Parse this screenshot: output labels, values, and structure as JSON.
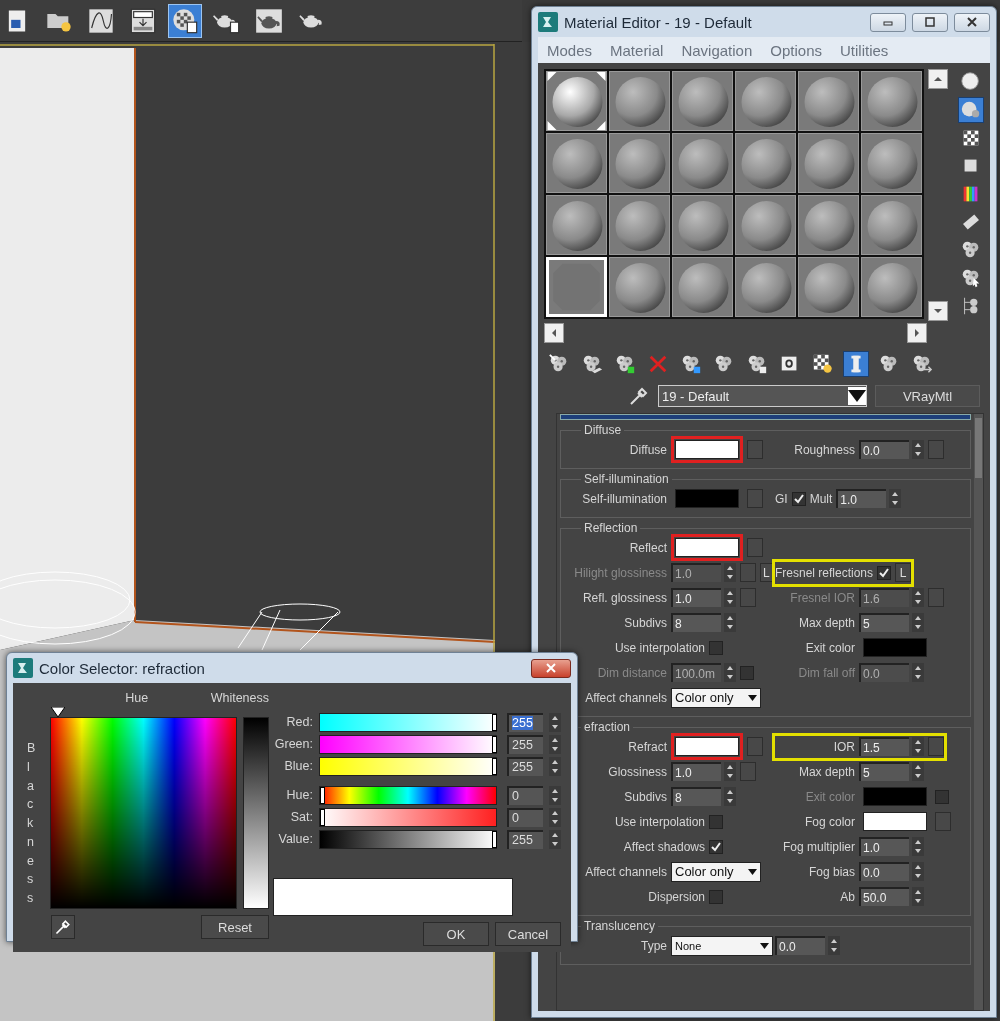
{
  "toolbar": {
    "tools": [
      {
        "kind": "doc",
        "selected": false
      },
      {
        "kind": "folder-bulb",
        "selected": false
      },
      {
        "kind": "curve",
        "selected": false
      },
      {
        "kind": "down-box",
        "selected": false
      },
      {
        "kind": "checker-sphere",
        "selected": true
      },
      {
        "kind": "teapot-doc",
        "selected": false
      },
      {
        "kind": "teapot-frame",
        "selected": false
      },
      {
        "kind": "teapot",
        "selected": false
      }
    ]
  },
  "material_editor": {
    "title": "Material Editor - 19 - Default",
    "menu": [
      "Modes",
      "Material",
      "Navigation",
      "Options",
      "Utilities"
    ],
    "slots": [
      {
        "kind": "sphere",
        "hot": true,
        "selected": false
      },
      {
        "kind": "sphere",
        "hot": false,
        "selected": false
      },
      {
        "kind": "sphere",
        "hot": false,
        "selected": false
      },
      {
        "kind": "sphere",
        "hot": false,
        "selected": false
      },
      {
        "kind": "sphere",
        "hot": false,
        "selected": false
      },
      {
        "kind": "sphere",
        "hot": false,
        "selected": false
      },
      {
        "kind": "sphere",
        "hot": false,
        "selected": false
      },
      {
        "kind": "sphere",
        "hot": false,
        "selected": false
      },
      {
        "kind": "sphere",
        "hot": false,
        "selected": false
      },
      {
        "kind": "sphere",
        "hot": false,
        "selected": false
      },
      {
        "kind": "sphere",
        "hot": false,
        "selected": false
      },
      {
        "kind": "sphere",
        "hot": false,
        "selected": false
      },
      {
        "kind": "sphere",
        "hot": false,
        "selected": false
      },
      {
        "kind": "sphere",
        "hot": false,
        "selected": false
      },
      {
        "kind": "sphere",
        "hot": false,
        "selected": false
      },
      {
        "kind": "sphere",
        "hot": false,
        "selected": false
      },
      {
        "kind": "sphere",
        "hot": false,
        "selected": false
      },
      {
        "kind": "sphere",
        "hot": false,
        "selected": false
      },
      {
        "kind": "flat",
        "hot": false,
        "selected": true
      },
      {
        "kind": "sphere",
        "hot": false,
        "selected": false
      },
      {
        "kind": "sphere",
        "hot": false,
        "selected": false
      },
      {
        "kind": "sphere",
        "hot": false,
        "selected": false
      },
      {
        "kind": "sphere",
        "hot": false,
        "selected": false
      },
      {
        "kind": "sphere",
        "hot": false,
        "selected": false
      }
    ],
    "side_tools": [
      {
        "kind": "sphere",
        "selected": false
      },
      {
        "kind": "sphere-backlight",
        "selected": true
      },
      {
        "kind": "checker",
        "selected": false
      },
      {
        "kind": "square",
        "selected": false
      },
      {
        "kind": "color-bars",
        "selected": false
      },
      {
        "kind": "film",
        "selected": false
      },
      {
        "kind": "cluster",
        "selected": false
      },
      {
        "kind": "cluster-cursor",
        "selected": false
      },
      {
        "kind": "cluster-tree",
        "selected": false
      }
    ],
    "bottom_tools": [
      {
        "kind": "cluster-wand",
        "selected": false
      },
      {
        "kind": "cluster-plane",
        "selected": false
      },
      {
        "kind": "cluster-cube",
        "selected": false
      },
      {
        "kind": "delete",
        "selected": false
      },
      {
        "kind": "cluster-arrows",
        "selected": false
      },
      {
        "kind": "cluster-pyramid",
        "selected": false
      },
      {
        "kind": "cluster-doc",
        "selected": false
      },
      {
        "kind": "square-zero",
        "selected": false
      },
      {
        "kind": "checker-bulb",
        "selected": false
      },
      {
        "kind": "pillar",
        "selected": true
      },
      {
        "kind": "cluster-head",
        "selected": false
      },
      {
        "kind": "cluster-head-arrow",
        "selected": false
      }
    ],
    "material_name": "19 - Default",
    "material_type": "VRayMtl",
    "groups": [
      {
        "title": "Diffuse",
        "rows": [
          {
            "left": {
              "disabled": false,
              "highlighted": false,
              "items": [
                {
                  "kind": "label",
                  "text": "Diffuse"
                },
                {
                  "kind": "swatch",
                  "color": "#ffffff",
                  "highlighted": true
                },
                {
                  "kind": "map"
                }
              ]
            },
            "right": {
              "disabled": false,
              "highlighted": false,
              "items": [
                {
                  "kind": "label",
                  "text": "Roughness"
                },
                {
                  "kind": "spinner",
                  "value": "0.0"
                },
                {
                  "kind": "map"
                }
              ]
            }
          }
        ]
      },
      {
        "title": "Self-illumination",
        "rows": [
          {
            "left": {
              "disabled": false,
              "highlighted": false,
              "items": [
                {
                  "kind": "label",
                  "text": "Self-illumination"
                },
                {
                  "kind": "swatch",
                  "color": "#000000",
                  "highlighted": false
                },
                {
                  "kind": "map"
                }
              ]
            },
            "right": {
              "disabled": false,
              "highlighted": false,
              "items": [
                {
                  "kind": "label",
                  "text": "GI"
                },
                {
                  "kind": "check",
                  "checked": true
                },
                {
                  "kind": "label",
                  "text": "Mult"
                },
                {
                  "kind": "spinner",
                  "value": "1.0"
                }
              ]
            }
          }
        ]
      },
      {
        "title": "Reflection",
        "rows": [
          {
            "left": {
              "disabled": false,
              "highlighted": false,
              "items": [
                {
                  "kind": "label",
                  "text": "Reflect"
                },
                {
                  "kind": "swatch",
                  "color": "#ffffff",
                  "highlighted": true
                },
                {
                  "kind": "map"
                }
              ]
            }
          },
          {
            "left": {
              "disabled": true,
              "highlighted": false,
              "items": [
                {
                  "kind": "label",
                  "text": "Hilight glossiness"
                },
                {
                  "kind": "spinner",
                  "value": "1.0"
                },
                {
                  "kind": "map"
                },
                {
                  "kind": "lock",
                  "text": "L"
                }
              ]
            },
            "right": {
              "disabled": false,
              "highlighted": true,
              "items": [
                {
                  "kind": "label",
                  "text": "Fresnel reflections"
                },
                {
                  "kind": "check",
                  "checked": true
                },
                {
                  "kind": "lock",
                  "text": "L"
                }
              ]
            }
          },
          {
            "left": {
              "disabled": false,
              "highlighted": false,
              "items": [
                {
                  "kind": "label",
                  "text": "Refl. glossiness"
                },
                {
                  "kind": "spinner",
                  "value": "1.0"
                },
                {
                  "kind": "map"
                }
              ]
            },
            "right": {
              "disabled": true,
              "highlighted": false,
              "items": [
                {
                  "kind": "label",
                  "text": "Fresnel IOR"
                },
                {
                  "kind": "spinner",
                  "value": "1.6"
                },
                {
                  "kind": "map"
                }
              ]
            }
          },
          {
            "left": {
              "disabled": false,
              "highlighted": false,
              "items": [
                {
                  "kind": "label",
                  "text": "Subdivs"
                },
                {
                  "kind": "spinner",
                  "value": "8"
                }
              ]
            },
            "right": {
              "disabled": false,
              "highlighted": false,
              "items": [
                {
                  "kind": "label",
                  "text": "Max depth"
                },
                {
                  "kind": "spinner",
                  "value": "5"
                }
              ]
            }
          },
          {
            "left": {
              "disabled": false,
              "highlighted": false,
              "items": [
                {
                  "kind": "label",
                  "text": "Use interpolation"
                },
                {
                  "kind": "check",
                  "checked": false
                }
              ]
            },
            "right": {
              "disabled": false,
              "highlighted": false,
              "items": [
                {
                  "kind": "label",
                  "text": "Exit color"
                },
                {
                  "kind": "swatch",
                  "color": "#000000",
                  "highlighted": false
                }
              ]
            }
          },
          {
            "left": {
              "disabled": true,
              "highlighted": false,
              "items": [
                {
                  "kind": "label",
                  "text": "Dim distance"
                },
                {
                  "kind": "spinner",
                  "value": "100.0m"
                },
                {
                  "kind": "check",
                  "checked": false
                }
              ]
            },
            "right": {
              "disabled": true,
              "highlighted": false,
              "items": [
                {
                  "kind": "label",
                  "text": "Dim fall off"
                },
                {
                  "kind": "spinner",
                  "value": "0.0"
                }
              ]
            }
          },
          {
            "left": {
              "disabled": false,
              "highlighted": false,
              "items": [
                {
                  "kind": "label",
                  "text": "Affect channels"
                },
                {
                  "kind": "dropdown",
                  "value": "Color only"
                }
              ]
            }
          }
        ]
      },
      {
        "title": "efraction",
        "rows": [
          {
            "left": {
              "disabled": false,
              "highlighted": false,
              "items": [
                {
                  "kind": "label",
                  "text": "Refract"
                },
                {
                  "kind": "swatch",
                  "color": "#ffffff",
                  "highlighted": true
                },
                {
                  "kind": "map"
                }
              ]
            },
            "right": {
              "disabled": false,
              "highlighted": true,
              "items": [
                {
                  "kind": "label",
                  "text": "IOR"
                },
                {
                  "kind": "spinner",
                  "value": "1.5"
                },
                {
                  "kind": "map"
                }
              ]
            }
          },
          {
            "left": {
              "disabled": false,
              "highlighted": false,
              "items": [
                {
                  "kind": "label",
                  "text": "Glossiness"
                },
                {
                  "kind": "spinner",
                  "value": "1.0"
                },
                {
                  "kind": "map"
                }
              ]
            },
            "right": {
              "disabled": false,
              "highlighted": false,
              "items": [
                {
                  "kind": "label",
                  "text": "Max depth"
                },
                {
                  "kind": "spinner",
                  "value": "5"
                }
              ]
            }
          },
          {
            "left": {
              "disabled": false,
              "highlighted": false,
              "items": [
                {
                  "kind": "label",
                  "text": "Subdivs"
                },
                {
                  "kind": "spinner",
                  "value": "8"
                }
              ]
            },
            "right": {
              "disabled": true,
              "highlighted": false,
              "items": [
                {
                  "kind": "label",
                  "text": "Exit color"
                },
                {
                  "kind": "swatch",
                  "color": "#000000",
                  "highlighted": false
                },
                {
                  "kind": "check",
                  "checked": false
                }
              ]
            }
          },
          {
            "left": {
              "disabled": false,
              "highlighted": false,
              "items": [
                {
                  "kind": "label",
                  "text": "Use interpolation"
                },
                {
                  "kind": "check",
                  "checked": false
                }
              ]
            },
            "right": {
              "disabled": false,
              "highlighted": false,
              "items": [
                {
                  "kind": "label",
                  "text": "Fog color"
                },
                {
                  "kind": "swatch",
                  "color": "#ffffff",
                  "highlighted": false
                },
                {
                  "kind": "map"
                }
              ]
            }
          },
          {
            "left": {
              "disabled": false,
              "highlighted": false,
              "items": [
                {
                  "kind": "label",
                  "text": "Affect shadows"
                },
                {
                  "kind": "check",
                  "checked": true
                }
              ]
            },
            "right": {
              "disabled": false,
              "highlighted": false,
              "items": [
                {
                  "kind": "label",
                  "text": "Fog multiplier"
                },
                {
                  "kind": "spinner",
                  "value": "1.0"
                }
              ]
            }
          },
          {
            "left": {
              "disabled": false,
              "highlighted": false,
              "items": [
                {
                  "kind": "label",
                  "text": "Affect channels"
                },
                {
                  "kind": "dropdown",
                  "value": "Color only"
                }
              ]
            },
            "right": {
              "disabled": false,
              "highlighted": false,
              "items": [
                {
                  "kind": "label",
                  "text": "Fog bias"
                },
                {
                  "kind": "spinner",
                  "value": "0.0"
                }
              ]
            }
          },
          {
            "left": {
              "disabled": false,
              "highlighted": false,
              "items": [
                {
                  "kind": "label",
                  "text": "Dispersion"
                },
                {
                  "kind": "check",
                  "checked": false
                }
              ]
            },
            "right": {
              "disabled": false,
              "highlighted": false,
              "items": [
                {
                  "kind": "label",
                  "text": "Ab"
                },
                {
                  "kind": "spinner",
                  "value": "50.0"
                }
              ]
            }
          }
        ]
      },
      {
        "title": "Translucency",
        "rows": [
          {
            "left": {
              "disabled": false,
              "highlighted": false,
              "items": [
                {
                  "kind": "label",
                  "text": "Type"
                },
                {
                  "kind": "wide-dropdown",
                  "value": "None"
                }
              ]
            },
            "right": {
              "disabled": false,
              "highlighted": false,
              "items": [
                {
                  "kind": "spinner",
                  "value": "0.0"
                }
              ]
            }
          }
        ]
      }
    ]
  },
  "color_selector": {
    "title": "Color Selector: refraction",
    "hue_label": "Hue",
    "whiteness_label": "Whiteness",
    "blackness_label": "Blackness",
    "channels": [
      {
        "kind": "red",
        "label": "Red:",
        "value": "255",
        "level": 1,
        "selected": true
      },
      {
        "kind": "green",
        "label": "Green:",
        "value": "255",
        "level": 1,
        "selected": false
      },
      {
        "kind": "blue",
        "label": "Blue:",
        "value": "255",
        "level": 1,
        "selected": false
      },
      {
        "kind": "hue",
        "label": "Hue:",
        "value": "0",
        "level": 0,
        "selected": false
      },
      {
        "kind": "sat",
        "label": "Sat:",
        "value": "0",
        "level": 0,
        "selected": false
      },
      {
        "kind": "value",
        "label": "Value:",
        "value": "255",
        "level": 1,
        "selected": false
      }
    ],
    "preview": {
      "color": "#ffffff"
    },
    "reset": "Reset",
    "ok": "OK",
    "cancel": "Cancel"
  }
}
